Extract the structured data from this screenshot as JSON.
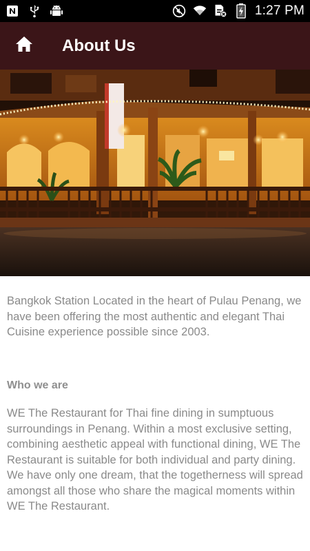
{
  "status_bar": {
    "time": "1:27 PM",
    "left_icons": [
      "notification-n-icon",
      "usb-icon",
      "android-debug-icon"
    ],
    "right_icons": [
      "mute-icon",
      "wifi-icon",
      "sim-no-signal-icon",
      "battery-charging-icon"
    ]
  },
  "app_bar": {
    "title": "About Us",
    "home_icon": "home-icon",
    "background": "#3b1518"
  },
  "hero": {
    "description_icon": "restaurant-exterior-photo"
  },
  "content": {
    "intro": "Bangkok Station Located in the heart of Pulau Penang, we have been offering the most authentic and elegant Thai Cuisine experience possible since 2003.",
    "section_heading": "Who we are",
    "section_body": "WE The Restaurant for Thai fine dining in sumptuous surroundings in Penang. Within a most exclusive setting, combining aesthetic appeal with functional dining, WE The Restaurant is suitable for both individual and party dining. We have only one dream, that the togetherness will spread amongst all those who share the magical moments within WE The Restaurant."
  }
}
